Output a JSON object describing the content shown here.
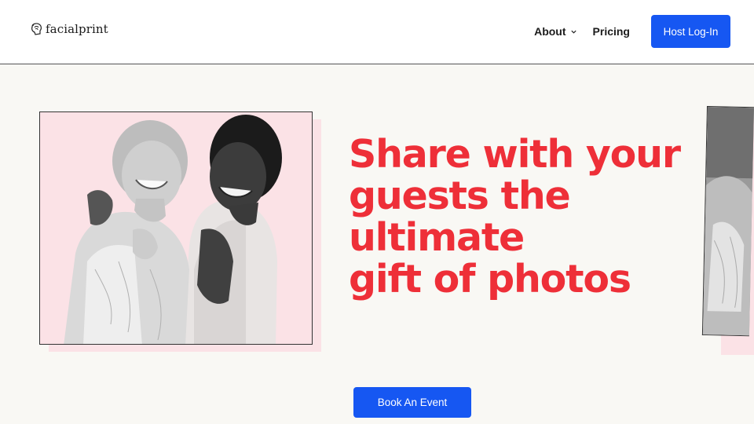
{
  "header": {
    "logo_text": "facialprint",
    "logo_icon": "face-fingerprint-icon",
    "nav": {
      "about_label": "About",
      "pricing_label": "Pricing",
      "host_login_label": "Host Log-In"
    }
  },
  "hero": {
    "headline_lines": [
      "Share with your",
      "guests the",
      "ultimate",
      "gift of photos"
    ],
    "cta_label": "Book An Event"
  },
  "colors": {
    "accent_blue": "#1657f2",
    "headline_red": "#ee2f38",
    "pink_block": "#fbe2e6",
    "page_bg": "#f9f8f4"
  }
}
